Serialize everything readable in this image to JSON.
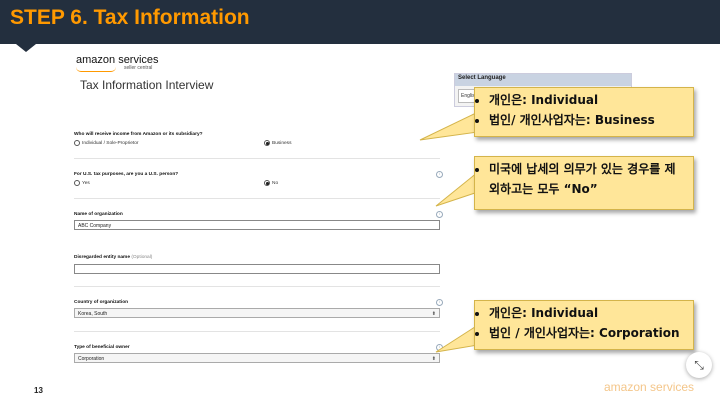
{
  "slide": {
    "title": "STEP 6. Tax Information",
    "page_number": "13",
    "footer_brand": "amazon services"
  },
  "screenshot": {
    "logo_main": "amazon services",
    "logo_sub": "seller central",
    "page_title": "Tax Information Interview",
    "language": {
      "label": "Select Language",
      "value": "English"
    },
    "questions": {
      "income_recipient": {
        "label": "Who will receive income from Amazon or its subsidiary?",
        "option_1": "Individual / Sole-Proprietor",
        "option_2": "Business",
        "selected": "Business"
      },
      "us_person": {
        "label": "For U.S. tax purposes, are you a U.S. person?",
        "option_1": "Yes",
        "option_2": "No",
        "selected": "No"
      },
      "org_name": {
        "label": "Name of organization",
        "value": "ABC Company"
      },
      "disregarded": {
        "label": "Disregarded entity name",
        "optional": "(Optional)",
        "value": ""
      },
      "country": {
        "label": "Country of organization",
        "value": "Korea, South"
      },
      "beneficial_owner": {
        "label": "Type of beneficial owner",
        "value": "Corporation"
      }
    }
  },
  "callouts": {
    "first": {
      "line1": "개인은: Individual",
      "line2": "법인/ 개인사업자는: Business"
    },
    "second": {
      "line1": "미국에 납세의 의무가 있는 경우를 제외하고는 모두 “No”"
    },
    "third": {
      "line1": "개인은: Individual",
      "line2": "법인 / 개인사업자는: Corporation"
    }
  },
  "colors": {
    "header_bg": "#232f3e",
    "header_text": "#ff9900",
    "callout_bg": "#ffe699"
  }
}
